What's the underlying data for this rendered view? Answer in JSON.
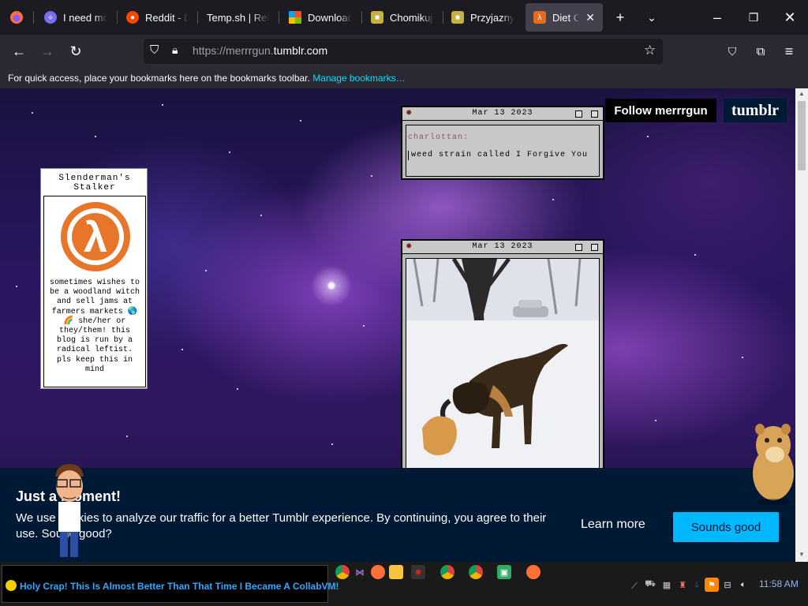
{
  "browser": {
    "tabs": [
      {
        "label": "I need mor",
        "favicon": "discord-style-icon",
        "color": "#7b6cf6"
      },
      {
        "label": "Reddit - Di",
        "favicon": "reddit-icon",
        "color": "#ff4500"
      },
      {
        "label": "Temp.sh | Retro",
        "favicon": "none",
        "color": ""
      },
      {
        "label": "Download",
        "favicon": "windows-icon",
        "color": "#0078d4"
      },
      {
        "label": "Chomikuj.p",
        "favicon": "chomikuj-icon",
        "color": "#c8b040"
      },
      {
        "label": "Przyjazny d",
        "favicon": "chomikuj-icon",
        "color": "#c8b040"
      },
      {
        "label": "Diet Cok",
        "favicon": "halflife-icon",
        "color": "#e86a1c",
        "active": true
      }
    ],
    "url_prefix": "https://merrrgun.",
    "url_host": "tumblr.com",
    "bookmarks_message": "For quick access, place your bookmarks here on the bookmarks toolbar.",
    "bookmarks_link": "Manage bookmarks…"
  },
  "blog": {
    "name": "Slenderman's Stalker",
    "description": "sometimes wishes to be a woodland witch and sell jams at farmers markets 🌎🌈 she/her or they/them! this blog is run by a radical leftist. pls keep this in mind",
    "follow_label": "Follow merrrgun",
    "tumblr_logo": "tumblr"
  },
  "posts": [
    {
      "date": "Mar 13 2023",
      "user": "charlottan:",
      "quote": "weed strain called I Forgive You"
    },
    {
      "date": "Mar 13 2023",
      "image": "dog playing in snow"
    }
  ],
  "cookie": {
    "title": "Just a moment!",
    "text": "We use cookies to analyze our traffic for a better Tumblr experience. By continuing, you agree to their use. Sound good?",
    "learn_more": "Learn more",
    "accept": "Sounds good"
  },
  "taskbar": {
    "marquee": "Holy Crap! This Is Almost Better Than That Time I Became A CollabVM!",
    "clock": "11:58 AM"
  }
}
